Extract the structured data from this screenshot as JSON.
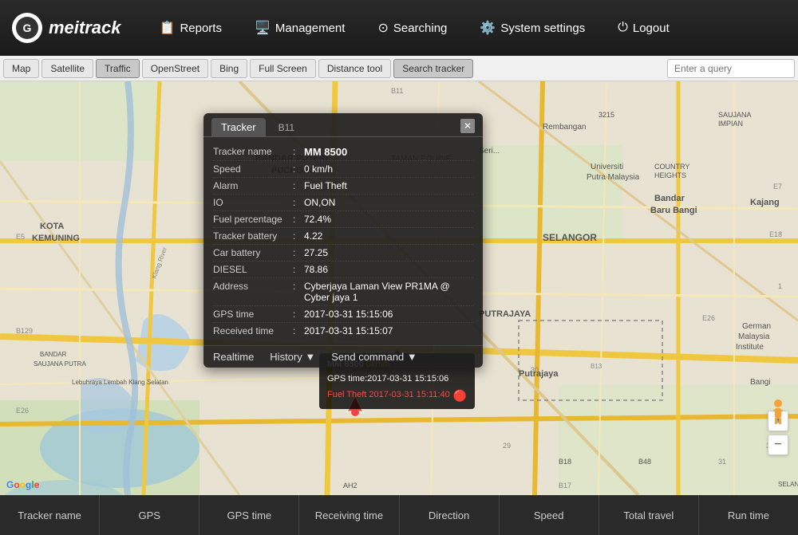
{
  "logo": {
    "icon": "G",
    "text": "meitrack"
  },
  "nav": {
    "items": [
      {
        "id": "reports",
        "icon": "📋",
        "label": "Reports"
      },
      {
        "id": "management",
        "icon": "🖥️",
        "label": "Management"
      },
      {
        "id": "searching",
        "icon": "⊙",
        "label": "Searching"
      },
      {
        "id": "system-settings",
        "icon": "⚙️",
        "label": "System settings"
      },
      {
        "id": "logout",
        "icon": "⏻",
        "label": "Logout"
      }
    ]
  },
  "toolbar": {
    "buttons": [
      {
        "id": "map",
        "label": "Map"
      },
      {
        "id": "satellite",
        "label": "Satellite"
      },
      {
        "id": "traffic",
        "label": "Traffic"
      },
      {
        "id": "openstreet",
        "label": "OpenStreet"
      },
      {
        "id": "bing",
        "label": "Bing"
      },
      {
        "id": "fullscreen",
        "label": "Full Screen"
      },
      {
        "id": "distance-tool",
        "label": "Distance tool"
      },
      {
        "id": "search-tracker",
        "label": "Search tracker"
      }
    ],
    "search_placeholder": "Enter a query"
  },
  "popup": {
    "tab_label": "Tracker",
    "b11_label": "B11",
    "close_label": "✕",
    "tracker_name_label": "Tracker name",
    "tracker_name_value": "MM 8500",
    "speed_label": "Speed",
    "speed_value": "0 km/h",
    "alarm_label": "Alarm",
    "alarm_value": "Fuel Theft",
    "io_label": "IO",
    "io_value": "ON,ON",
    "fuel_label": "Fuel percentage",
    "fuel_value": "72.4%",
    "battery_label": "Tracker battery",
    "battery_value": "4.22",
    "car_battery_label": "Car battery",
    "car_battery_value": "27.25",
    "diesel_label": "DIESEL",
    "diesel_value": "78.86",
    "address_label": "Address",
    "address_value": "Cyberjaya Laman View PR1MA @ Cyber jaya 1",
    "gps_time_label": "GPS time",
    "gps_time_value": "2017-03-31 15:15:06",
    "received_label": "Received time",
    "received_value": "2017-03-31 15:15:07",
    "realtime_btn": "Realtime",
    "history_btn": "History ▼",
    "command_btn": "Send command ▼"
  },
  "vehicle_tooltip": {
    "name": "MM 8500",
    "speed": "0km/h",
    "gps_time": "GPS time:2017-03-31 15:15:06",
    "alert": "Fuel Theft 2017-03-31 15:11:40"
  },
  "status_bar": {
    "columns": [
      {
        "id": "tracker-name",
        "label": "Tracker name"
      },
      {
        "id": "gps",
        "label": "GPS"
      },
      {
        "id": "gps-time",
        "label": "GPS time"
      },
      {
        "id": "receiving-time",
        "label": "Receiving time"
      },
      {
        "id": "direction",
        "label": "Direction"
      },
      {
        "id": "speed",
        "label": "Speed"
      },
      {
        "id": "total-travel",
        "label": "Total travel"
      },
      {
        "id": "run-time",
        "label": "Run time"
      }
    ]
  },
  "map": {
    "road_color": "#f5e8c0",
    "highway_color": "#f0a830",
    "water_color": "#a0c8e8",
    "land_color": "#e8e0d0",
    "green_color": "#c8e0b0"
  }
}
